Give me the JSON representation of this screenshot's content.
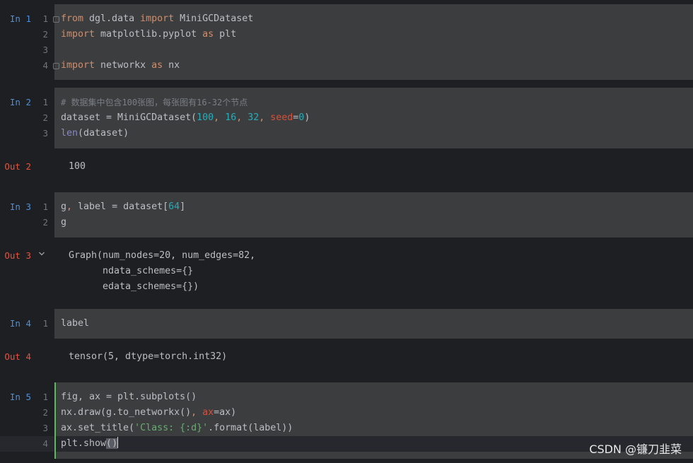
{
  "cells": [
    {
      "in_label": "In 1",
      "lines": [
        "1",
        "2",
        "3",
        "4"
      ],
      "code": {
        "l1_kw1": "from",
        "l1_mod": " dgl.data ",
        "l1_kw2": "import",
        "l1_name": " MiniGCDataset",
        "l2_kw1": "import",
        "l2_mod": " matplotlib.pyplot ",
        "l2_kw2": "as",
        "l2_name": " plt",
        "l4_kw1": "import",
        "l4_mod": " networkx ",
        "l4_kw2": "as",
        "l4_name": " nx"
      }
    },
    {
      "in_label": "In 2",
      "lines": [
        "1",
        "2",
        "3"
      ],
      "code": {
        "l1_comment": "# 数据集中包含100张图，每张图有16-32个节点",
        "l2_a": "dataset = MiniGCDataset(",
        "l2_n1": "100",
        "l2_c1": ", ",
        "l2_n2": "16",
        "l2_c2": ", ",
        "l2_n3": "32",
        "l2_c3": ", ",
        "l2_param": "seed",
        "l2_eq": "=",
        "l2_n4": "0",
        "l2_close": ")",
        "l3_builtin": "len",
        "l3_rest": "(dataset)"
      },
      "out_label": "Out 2",
      "output": [
        "100"
      ]
    },
    {
      "in_label": "In 3",
      "lines": [
        "1",
        "2"
      ],
      "code": {
        "l1_a": "g",
        "l1_comma": ",",
        "l1_b": " label = dataset[",
        "l1_num": "64",
        "l1_close": "]",
        "l2": "g"
      },
      "out_label": "Out 3",
      "output": [
        "Graph(num_nodes=20, num_edges=82,",
        "      ndata_schemes={}",
        "      edata_schemes={})"
      ]
    },
    {
      "in_label": "In 4",
      "lines": [
        "1"
      ],
      "code": {
        "l1": "label"
      },
      "out_label": "Out 4",
      "output": [
        "tensor(5, dtype=torch.int32)"
      ]
    },
    {
      "in_label": "In 5",
      "lines": [
        "1",
        "2",
        "3",
        "4"
      ],
      "code": {
        "l1": "fig, ax = plt.subplots()",
        "l2_a": "nx.draw(g.to_networkx()",
        "l2_comma": ", ",
        "l2_param": "ax",
        "l2_rest": "=ax)",
        "l3_a": "ax.set_title(",
        "l3_str": "'Class: {:d}'",
        "l3_rest": ".format(label))",
        "l4_a": "plt.show",
        "l4_paren_open": "(",
        "l4_paren_close": ")"
      }
    }
  ],
  "watermark": "CSDN @镰刀韭菜",
  "colors": {
    "background": "#1e1f22",
    "code_block": "#3c3d3f",
    "in_label": "#4f8fd8",
    "out_label": "#e5533d",
    "keyword": "#cf8e6d",
    "number": "#2aacb8",
    "string": "#6aab73",
    "active_cell_bar": "#5fb85f"
  },
  "icons": {
    "fold": "fold-marker-icon",
    "collapse_output": "chevron-down-icon"
  }
}
